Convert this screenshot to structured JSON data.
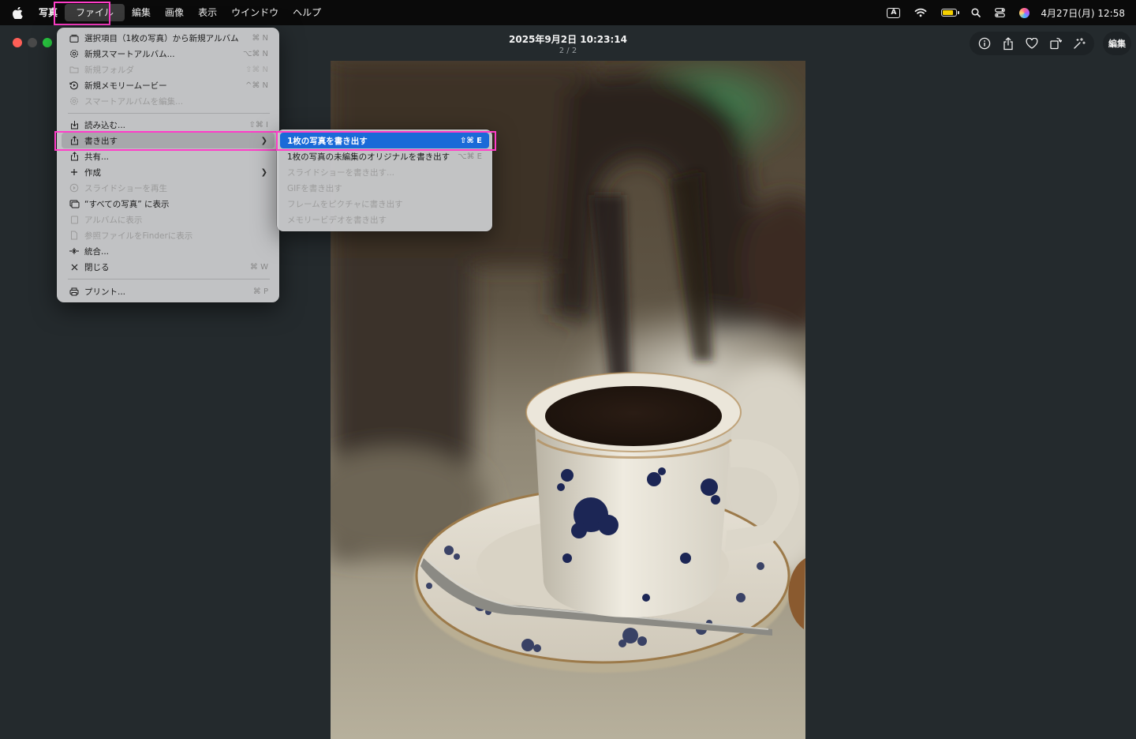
{
  "menubar": {
    "apple_icon": "apple-logo-icon",
    "items": [
      {
        "label": "写真"
      },
      {
        "label": "ファイル"
      },
      {
        "label": "編集"
      },
      {
        "label": "画像"
      },
      {
        "label": "表示"
      },
      {
        "label": "ウインドウ"
      },
      {
        "label": "ヘルプ"
      }
    ],
    "status": {
      "input_method": "A",
      "clock": "4月27日(月) 12:58",
      "battery_color": "#f5d000"
    }
  },
  "window": {
    "title": "2025年9月2日 10:23:14",
    "subtitle": "2 / 2",
    "edit_label": "編集",
    "toolbar_icons": [
      "info-icon",
      "share-icon",
      "heart-icon",
      "rotate-icon",
      "enhance-icon"
    ],
    "traffic_lights": {
      "close": "#fe5f57",
      "minimize": "#4a4a4a",
      "zoom": "#29c840"
    }
  },
  "file_menu": {
    "items": [
      {
        "label": "選択項目（1枚の写真）から新規アルバム",
        "shortcut": "⌘ N",
        "icon": "album-icon",
        "disabled": false
      },
      {
        "label": "新規スマートアルバム...",
        "shortcut": "⌥⌘ N",
        "icon": "gear-icon",
        "disabled": false
      },
      {
        "label": "新規フォルダ",
        "shortcut": "⇧⌘ N",
        "icon": "folder-icon",
        "disabled": true
      },
      {
        "label": "新規メモリームービー",
        "shortcut": "^⌘ N",
        "icon": "memory-icon",
        "disabled": false
      },
      {
        "label": "スマートアルバムを編集...",
        "shortcut": "",
        "icon": "gear-icon",
        "disabled": true
      },
      {
        "label": "読み込む...",
        "shortcut": "⇧⌘ I",
        "icon": "import-icon",
        "disabled": false
      },
      {
        "label": "書き出す",
        "shortcut": "",
        "icon": "export-icon",
        "disabled": false,
        "submenu": true,
        "selected": true
      },
      {
        "label": "共有...",
        "shortcut": "",
        "icon": "share-icon",
        "disabled": false
      },
      {
        "label": "作成",
        "shortcut": "",
        "icon": "plus-icon",
        "disabled": false,
        "submenu": true
      },
      {
        "label": "スライドショーを再生",
        "shortcut": "",
        "icon": "play-icon",
        "disabled": true
      },
      {
        "label": "“すべての写真” に表示",
        "shortcut": "",
        "icon": "photos-icon",
        "disabled": false
      },
      {
        "label": "アルバムに表示",
        "shortcut": "",
        "icon": "album-icon",
        "disabled": true
      },
      {
        "label": "参照ファイルをFinderに表示",
        "shortcut": "",
        "icon": "document-icon",
        "disabled": true
      },
      {
        "label": "統合...",
        "shortcut": "",
        "icon": "merge-icon",
        "disabled": false
      },
      {
        "label": "閉じる",
        "shortcut": "⌘ W",
        "icon": "close-icon",
        "disabled": false
      },
      {
        "label": "プリント...",
        "shortcut": "⌘ P",
        "icon": "printer-icon",
        "disabled": false
      }
    ]
  },
  "export_submenu": {
    "items": [
      {
        "label": "1枚の写真を書き出す",
        "shortcut": "⇧⌘ E",
        "active": true,
        "disabled": false
      },
      {
        "label": "1枚の写真の未編集のオリジナルを書き出す",
        "shortcut": "⌥⌘ E",
        "active": false,
        "disabled": false
      },
      {
        "label": "スライドショーを書き出す...",
        "shortcut": "",
        "active": false,
        "disabled": true
      },
      {
        "label": "GIFを書き出す",
        "shortcut": "",
        "active": false,
        "disabled": true
      },
      {
        "label": "フレームをピクチャに書き出す",
        "shortcut": "",
        "active": false,
        "disabled": true
      },
      {
        "label": "メモリービデオを書き出す",
        "shortcut": "",
        "active": false,
        "disabled": true
      }
    ]
  },
  "highlight_color": "#ff3dc8",
  "accent_color": "#1a6ad8"
}
